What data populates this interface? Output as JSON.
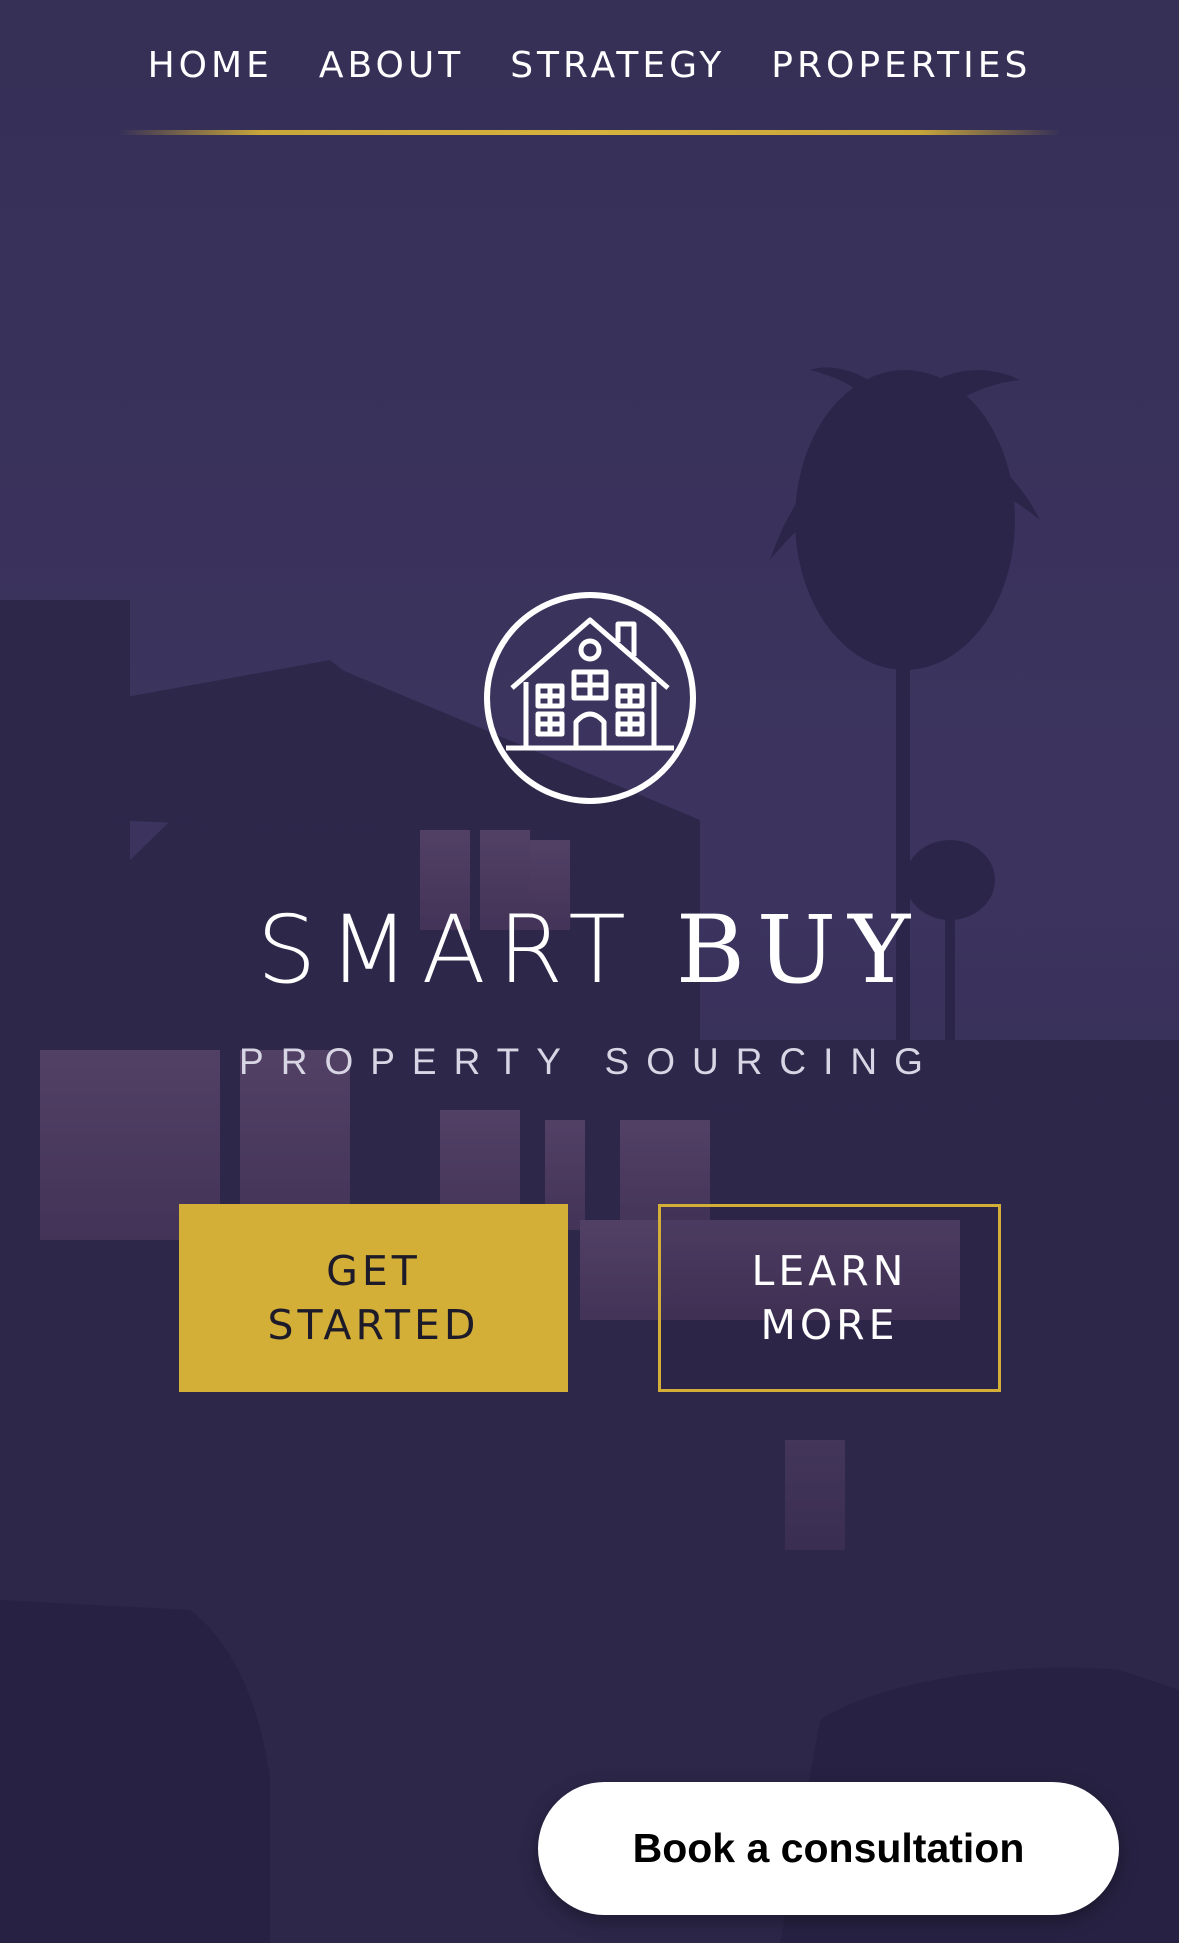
{
  "nav": {
    "items": [
      {
        "label": "HOME"
      },
      {
        "label": "ABOUT"
      },
      {
        "label": "STRATEGY"
      },
      {
        "label": "PROPERTIES"
      }
    ]
  },
  "brand": {
    "title_part1": "SMART",
    "title_part2": "BUY",
    "subtitle": "PROPERTY SOURCING",
    "logo_icon": "house-in-circle-icon"
  },
  "cta": {
    "primary_line1": "GET",
    "primary_line2": "STARTED",
    "secondary_line1": "LEARN",
    "secondary_line2": "MORE"
  },
  "consult_button": {
    "label": "Book a consultation"
  },
  "colors": {
    "accent_gold": "#d4af37",
    "background_purple": "#3a3358",
    "text_white": "#ffffff"
  }
}
